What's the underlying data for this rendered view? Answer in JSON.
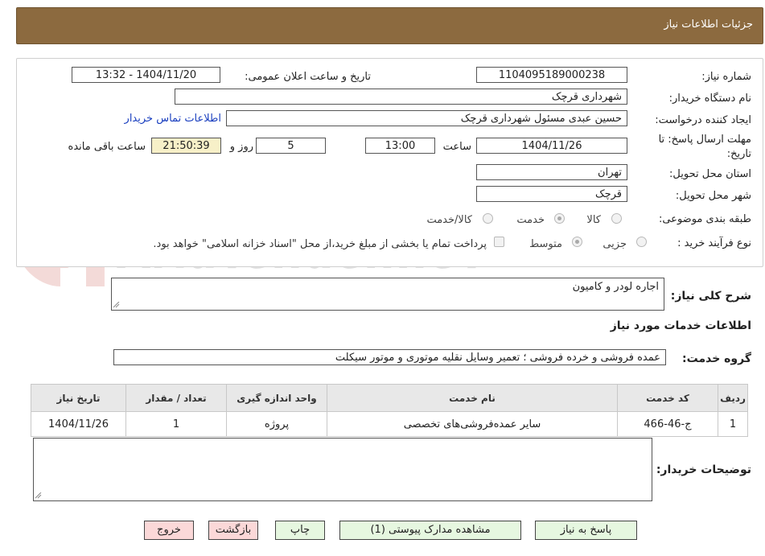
{
  "header": {
    "title": "جزئیات اطلاعات نیاز"
  },
  "form": {
    "need_number_label": "شماره نیاز:",
    "need_number": "1104095189000238",
    "announce_label": "تاریخ و ساعت اعلان عمومی:",
    "announce_value": "1404/11/20 - 13:32",
    "buyer_org_label": "نام دستگاه خریدار:",
    "buyer_org": "شهرداری قرچک",
    "creator_label": "ایجاد کننده درخواست:",
    "creator": "حسین عبدی مسئول شهرداری قرچک",
    "contact_link": "اطلاعات تماس خریدار",
    "deadline_label_1": "مهلت ارسال پاسخ: تا",
    "deadline_label_2": "تاریخ:",
    "deadline_date": "1404/11/26",
    "time_label": "ساعت",
    "deadline_time": "13:00",
    "days": "5",
    "days_label": "روز و",
    "remaining": "21:50:39",
    "remaining_label": "ساعت باقی مانده",
    "province_label": "استان محل تحویل:",
    "province": "تهران",
    "city_label": "شهر محل تحویل:",
    "city": "قرچک",
    "category_label": "طبقه بندی موضوعی:",
    "category_options": [
      "کالا",
      "خدمت",
      "کالا/خدمت"
    ],
    "category_selected": "خدمت",
    "process_label": "نوع فرآیند خرید :",
    "process_options": [
      "جزیی",
      "متوسط"
    ],
    "process_selected": "متوسط",
    "treasury_note": "پرداخت تمام یا بخشی از مبلغ خرید،از محل \"اسناد خزانه اسلامی\" خواهد بود."
  },
  "description": {
    "label": "شرح کلی نیاز:",
    "value": "اجاره لودر و کامیون"
  },
  "services": {
    "section_title": "اطلاعات خدمات مورد نیاز",
    "group_label": "گروه خدمت:",
    "group_value": "عمده فروشی و خرده فروشی ؛ تعمیر وسایل نقلیه موتوری و موتور سیکلت",
    "columns": [
      "ردیف",
      "کد خدمت",
      "نام خدمت",
      "واحد اندازه گیری",
      "تعداد / مقدار",
      "تاریخ نیاز"
    ],
    "rows": [
      [
        "1",
        "ج-46-466",
        "سایر عمده‌فروشی‌های تخصصی",
        "پروژه",
        "1",
        "1404/11/26"
      ]
    ]
  },
  "buyer_notes": {
    "label": "توضیحات خریدار:",
    "value": ""
  },
  "buttons": {
    "reply": "پاسخ به نیاز",
    "attachments": "مشاهده مدارک پیوستی (1)",
    "print": "چاپ",
    "back": "بازگشت",
    "exit": "خروج"
  },
  "watermark": {
    "text": "AriaTender.neT"
  },
  "colors": {
    "header_bg": "#8c6a3f",
    "yellow_field": "#f7f0c8",
    "green_btn": "#e6f7e0",
    "pink_btn": "#fbd8d8",
    "link": "#1a3fbf"
  }
}
